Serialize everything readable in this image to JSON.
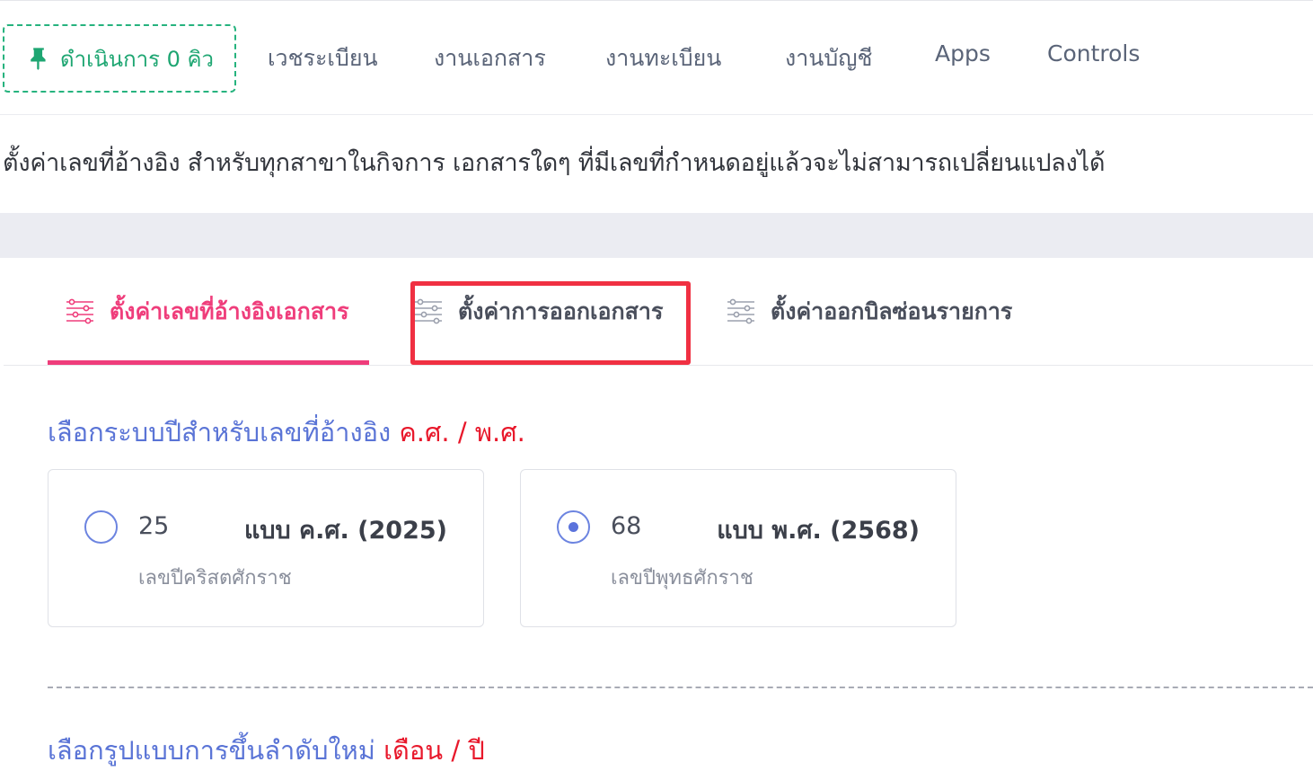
{
  "topnav": {
    "queue_button": "ดำเนินการ 0 คิว",
    "items": [
      "เวชระเบียน",
      "งานเอกสาร",
      "งานทะเบียน",
      "งานบัญชี",
      "Apps",
      "Controls"
    ]
  },
  "notice": {
    "text": "ตั้งค่าเลขที่อ้างอิง สำหรับทุกสาขาในกิจการ   เอกสารใดๆ ที่มีเลขที่กำหนดอยู่แล้วจะไม่สามารถเปลี่ยนแปลงได้"
  },
  "tabs": [
    {
      "label": "ตั้งค่าเลขที่อ้างอิงเอกสาร",
      "active": true
    },
    {
      "label": "ตั้งค่าการออกเอกสาร",
      "active": false
    },
    {
      "label": "ตั้งค่าออกบิลซ่อนรายการ",
      "active": false
    }
  ],
  "year_section": {
    "title": "เลือกระบบปีสำหรับเลขที่อ้างอิง",
    "title_highlight": "ค.ศ. / พ.ศ.",
    "options": [
      {
        "num": "25",
        "label": "แบบ ค.ศ. (2025)",
        "sub": "เลขปีคริสตศักราช",
        "checked": false
      },
      {
        "num": "68",
        "label": "แบบ พ.ศ. (2568)",
        "sub": "เลขปีพุทธศักราช",
        "checked": true
      }
    ]
  },
  "next_section": {
    "title": "เลือกรูปแบบการขึ้นลำดับใหม่",
    "title_highlight": "เดือน / ปี"
  },
  "colors": {
    "accent_pink": "#ef3d7b",
    "accent_blue": "#5a74d6",
    "highlight_red": "#e8182b",
    "queue_green": "#1ea672"
  }
}
